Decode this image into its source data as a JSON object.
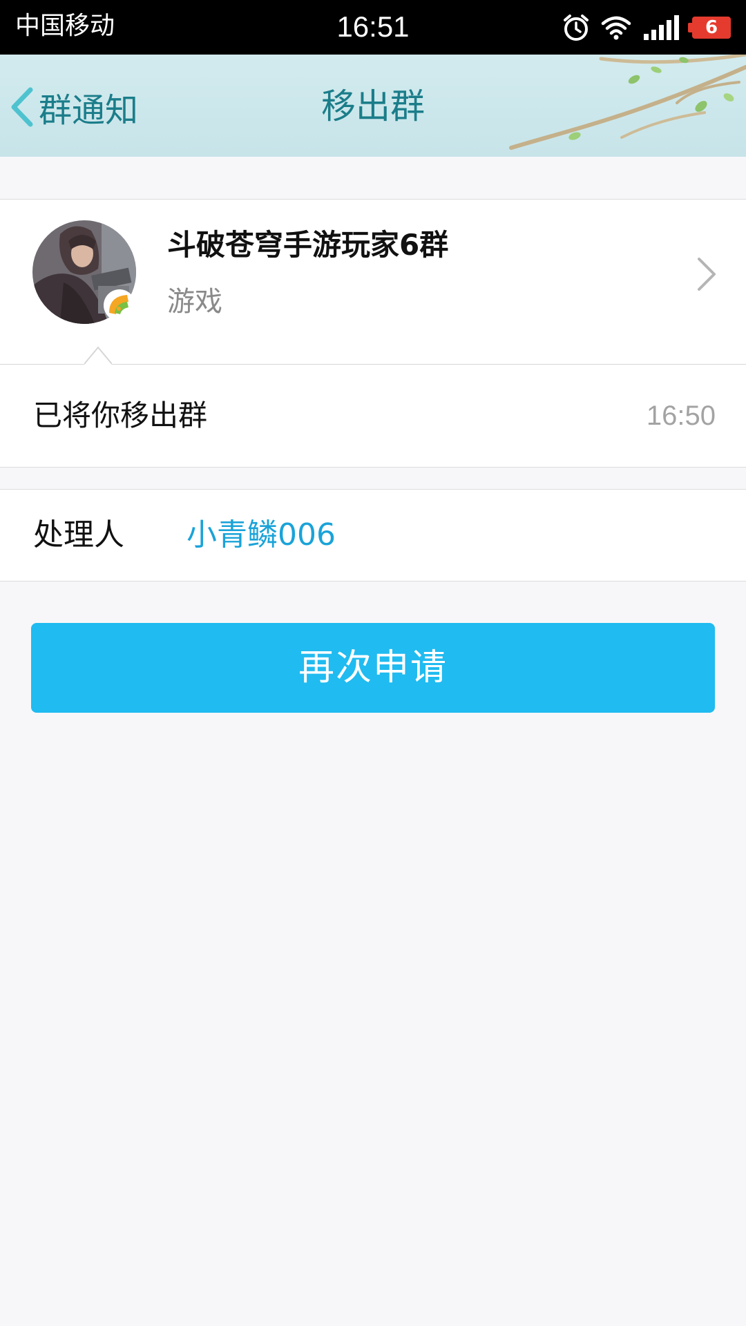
{
  "status_bar": {
    "carrier": "中国移动",
    "time": "16:51",
    "battery_level": "6",
    "icons": [
      "alarm-icon",
      "wifi-icon",
      "signal-icon",
      "battery-icon"
    ]
  },
  "nav": {
    "back_label": "群通知",
    "title": "移出群"
  },
  "group": {
    "name": "斗破苍穹手游玩家6群",
    "category": "游戏"
  },
  "notice": {
    "text": "已将你移出群",
    "time": "16:50"
  },
  "handler": {
    "label": "处理人",
    "name": "小青鳞006"
  },
  "actions": {
    "reapply_label": "再次申请"
  },
  "colors": {
    "accent": "#20bbf0",
    "link": "#1aa3d8",
    "nav_text": "#1b7d8a",
    "battery_low": "#e53b2e"
  }
}
